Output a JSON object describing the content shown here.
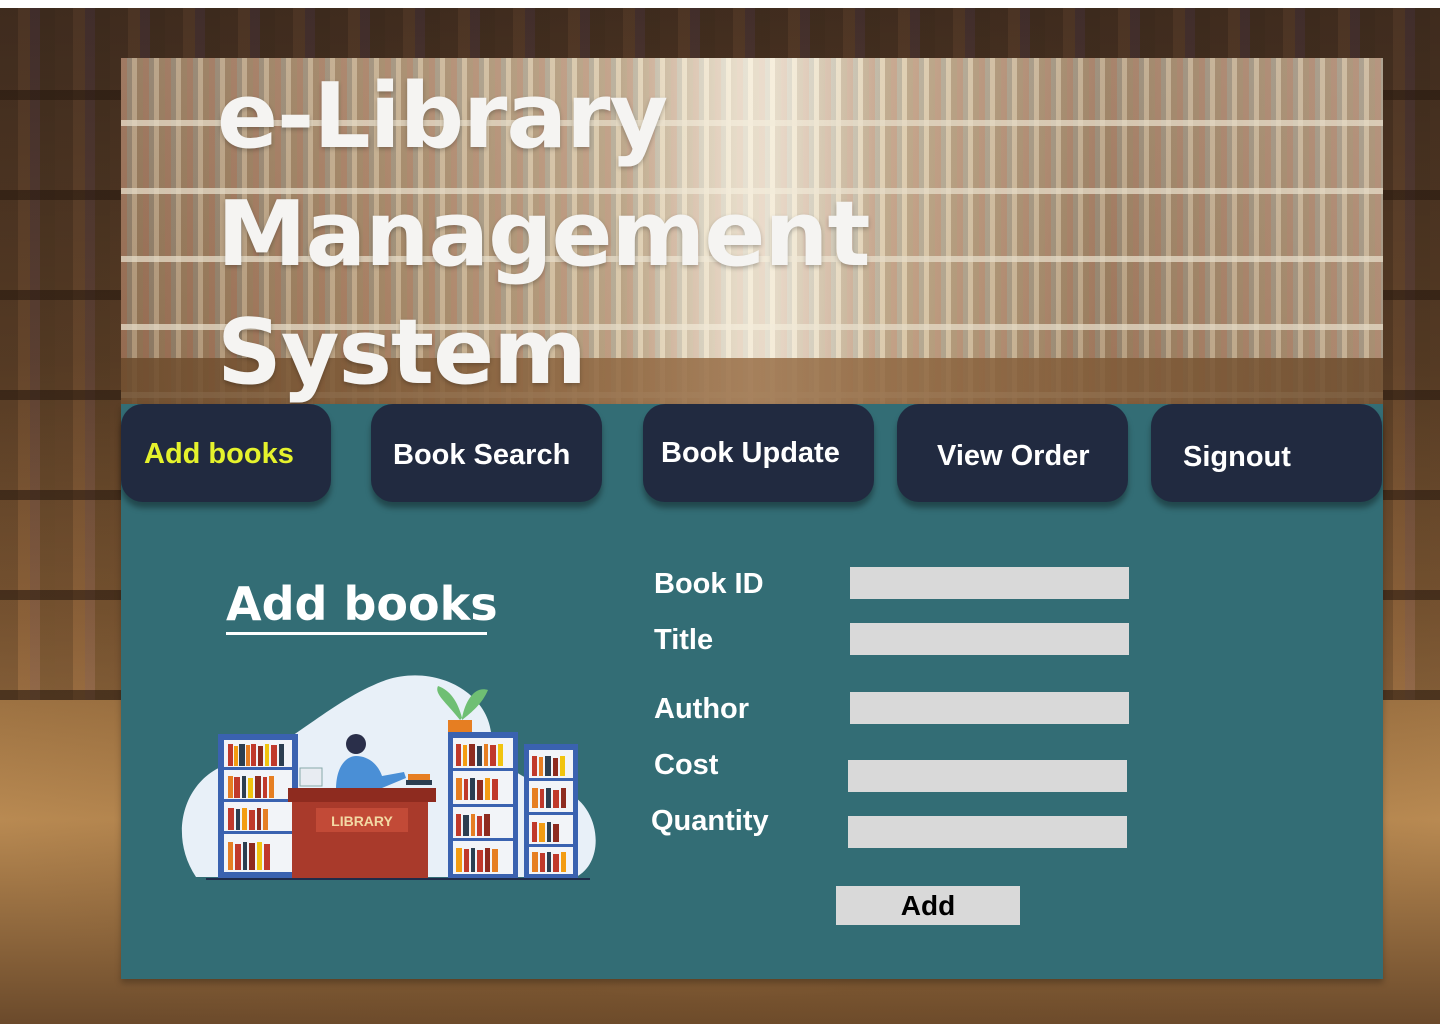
{
  "app": {
    "title_lines": [
      "e-Library",
      "Management",
      "System"
    ]
  },
  "nav": {
    "items": [
      {
        "label": "Add books",
        "active": true
      },
      {
        "label": "Book Search",
        "active": false
      },
      {
        "label": "Book Update",
        "active": false
      },
      {
        "label": "View Order",
        "active": false
      },
      {
        "label": "Signout",
        "active": false
      }
    ]
  },
  "main": {
    "section_title": "Add books",
    "illustration_sign": "LIBRARY",
    "form": {
      "fields": [
        {
          "label": "Book ID",
          "value": ""
        },
        {
          "label": "Title",
          "value": ""
        },
        {
          "label": "Author",
          "value": ""
        },
        {
          "label": "Cost",
          "value": ""
        },
        {
          "label": "Quantity",
          "value": ""
        }
      ],
      "submit_label": "Add"
    }
  },
  "colors": {
    "panel": "#336d75",
    "nav_button": "#212a40",
    "active_nav_text": "#e5f22c",
    "input_bg": "#d9d9d9"
  }
}
